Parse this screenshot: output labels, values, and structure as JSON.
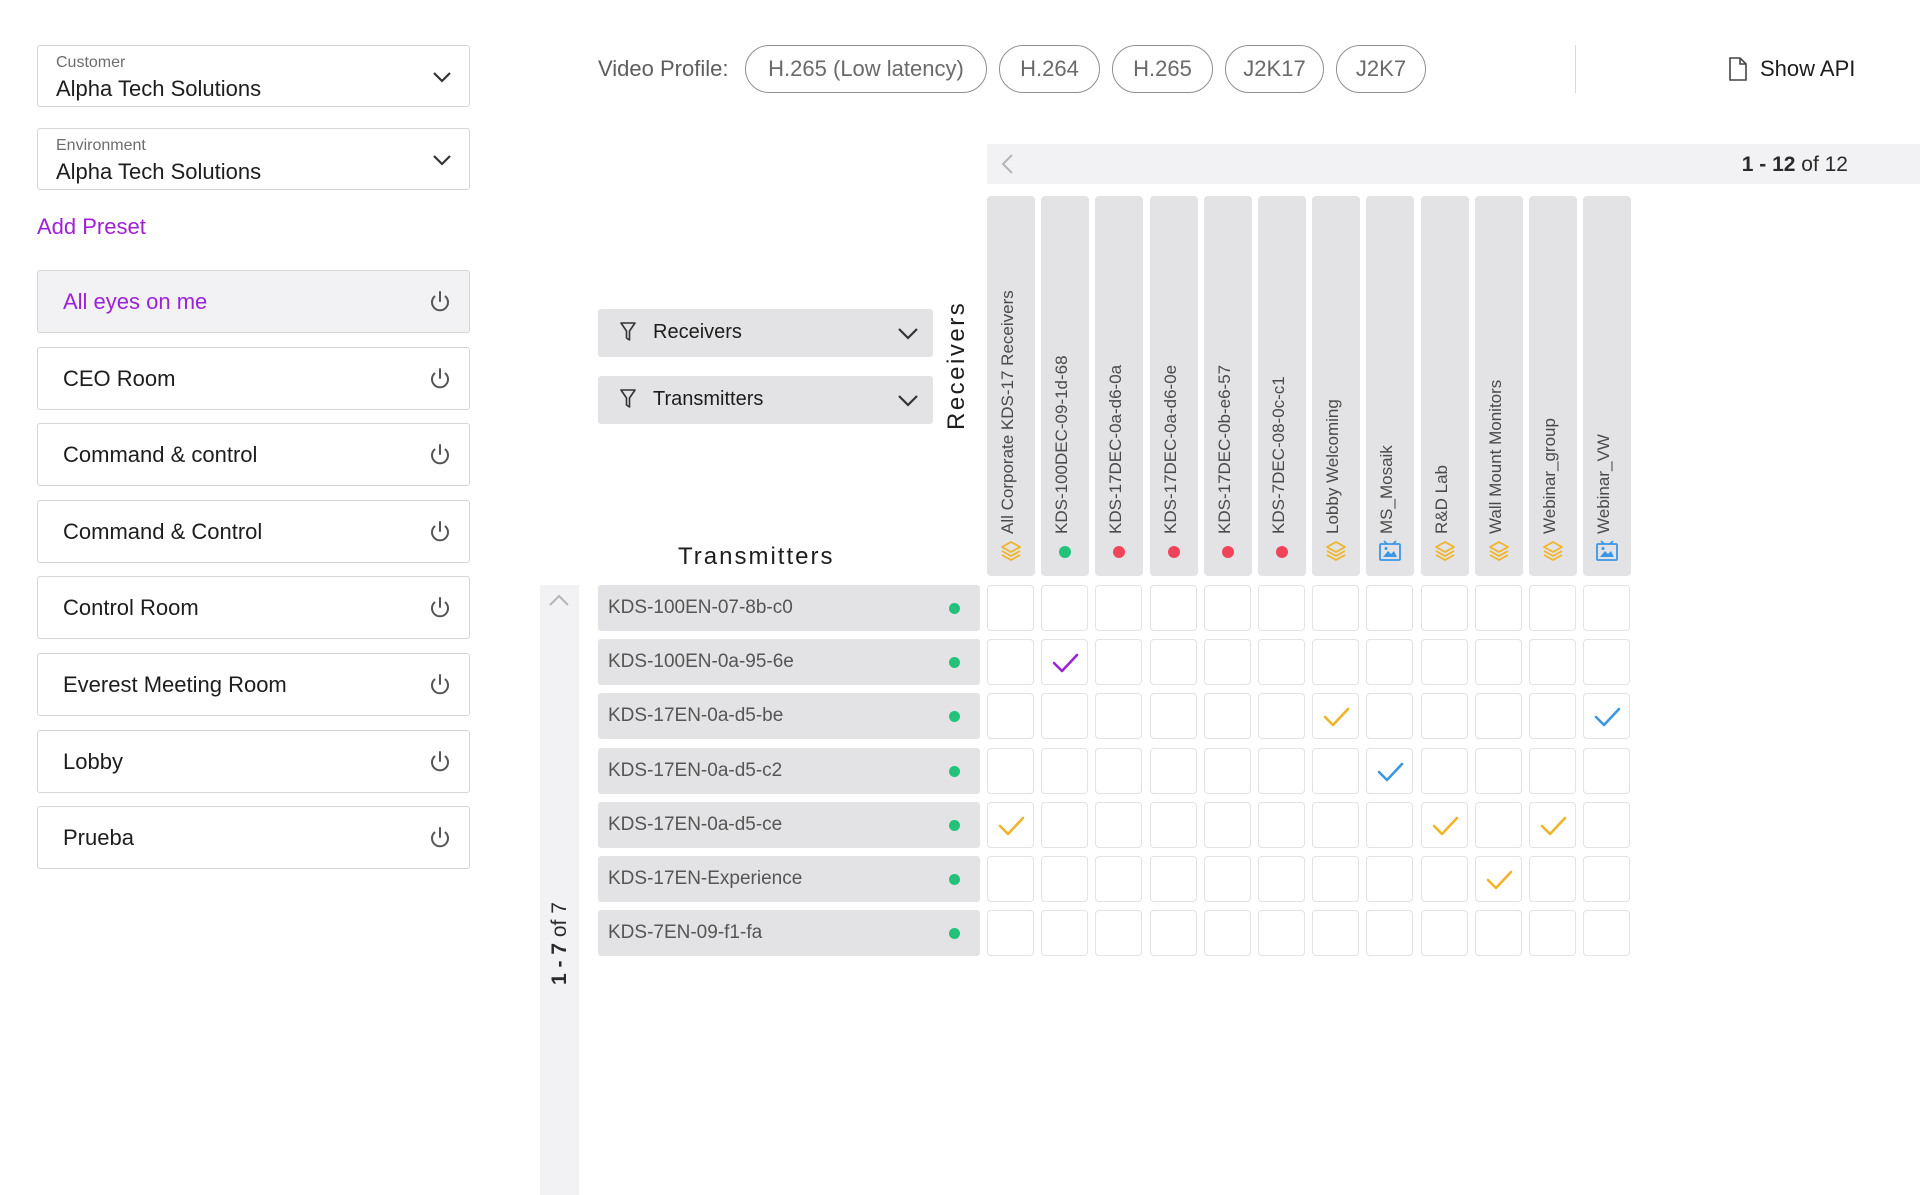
{
  "left_panel": {
    "customer": {
      "label": "Customer",
      "value": "Alpha Tech Solutions"
    },
    "environment": {
      "label": "Environment",
      "value": "Alpha Tech Solutions"
    },
    "add_preset": "Add Preset",
    "presets": [
      {
        "name": "All eyes on me",
        "active": true
      },
      {
        "name": "CEO Room"
      },
      {
        "name": "Command & control"
      },
      {
        "name": "Command & Control"
      },
      {
        "name": "Control Room"
      },
      {
        "name": "Everest Meeting Room"
      },
      {
        "name": "Lobby"
      },
      {
        "name": "Prueba"
      }
    ]
  },
  "topbar": {
    "video_profile_label": "Video Profile:",
    "profiles": [
      "H.265 (Low latency)",
      "H.264",
      "H.265",
      "J2K17",
      "J2K7"
    ],
    "show_api": "Show API"
  },
  "receivers_pager": {
    "range": "1 - 12",
    "of": "of 12"
  },
  "filters": {
    "receivers": "Receivers",
    "transmitters": "Transmitters"
  },
  "headings": {
    "receivers": "Receivers",
    "transmitters": "Transmitters"
  },
  "receivers": [
    {
      "name": "All Corporate KDS-17 Receivers",
      "icon": "layers-icon"
    },
    {
      "name": "KDS-100DEC-09-1d-68",
      "status": "online"
    },
    {
      "name": "KDS-17DEC-0a-d6-0a",
      "status": "offline"
    },
    {
      "name": "KDS-17DEC-0a-d6-0e",
      "status": "offline"
    },
    {
      "name": "KDS-17DEC-0b-e6-57",
      "status": "offline"
    },
    {
      "name": "KDS-7DEC-08-0c-c1",
      "status": "offline"
    },
    {
      "name": "Lobby Welcoming",
      "icon": "layers-icon"
    },
    {
      "name": "MS_Mosaik",
      "icon": "videowall-icon"
    },
    {
      "name": "R&D Lab",
      "icon": "layers-icon"
    },
    {
      "name": "Wall Mount Monitors",
      "icon": "layers-icon"
    },
    {
      "name": "Webinar_group",
      "icon": "layers-icon"
    },
    {
      "name": "Webinar_VW",
      "icon": "videowall-icon"
    }
  ],
  "transmitters_pager": {
    "range": "1 - 7",
    "of": "of 7"
  },
  "transmitters": [
    {
      "name": "KDS-100EN-07-8b-c0",
      "status": "online"
    },
    {
      "name": "KDS-100EN-0a-95-6e",
      "status": "online"
    },
    {
      "name": "KDS-17EN-0a-d5-be",
      "status": "online"
    },
    {
      "name": "KDS-17EN-0a-d5-c2",
      "status": "online"
    },
    {
      "name": "KDS-17EN-0a-d5-ce",
      "status": "online"
    },
    {
      "name": "KDS-17EN-Experience",
      "status": "online"
    },
    {
      "name": "KDS-7EN-09-f1-fa",
      "status": "online"
    }
  ],
  "routes": [
    {
      "row": 1,
      "col": 1,
      "color": "purple"
    },
    {
      "row": 2,
      "col": 6,
      "color": "yellow"
    },
    {
      "row": 2,
      "col": 11,
      "color": "blue"
    },
    {
      "row": 3,
      "col": 7,
      "color": "blue"
    },
    {
      "row": 4,
      "col": 0,
      "color": "yellow"
    },
    {
      "row": 4,
      "col": 8,
      "color": "yellow"
    },
    {
      "row": 4,
      "col": 10,
      "color": "yellow"
    },
    {
      "row": 5,
      "col": 9,
      "color": "yellow"
    }
  ],
  "colors": {
    "accent": "#9b22d6",
    "online": "#22c27a",
    "offline": "#f0445a",
    "group": "#f0b429",
    "videowall": "#3b96e6",
    "check_purple": "#9b22d6",
    "check_yellow": "#f0b429",
    "check_blue": "#3b96e6"
  }
}
